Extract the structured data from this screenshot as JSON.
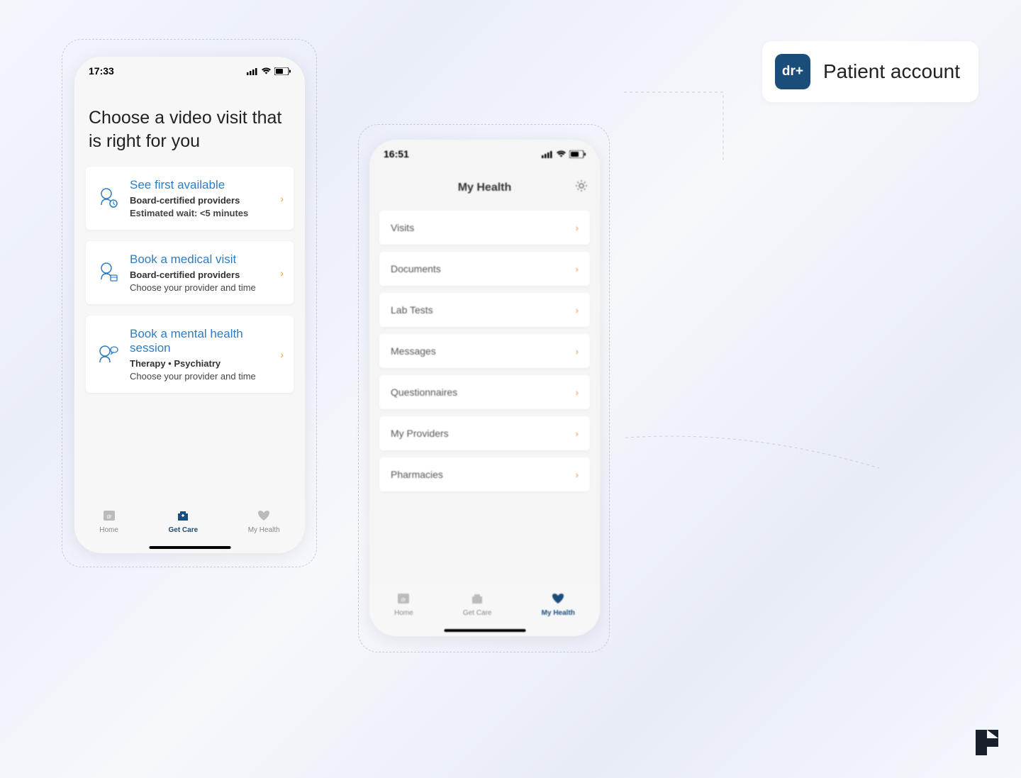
{
  "badge": {
    "logo_text": "dr+",
    "label": "Patient account"
  },
  "phone1": {
    "status_time": "17:33",
    "title": "Choose a video visit that is right for you",
    "cards": [
      {
        "title": "See first available",
        "line1": "Board-certified providers",
        "line2": "Estimated wait: <5 minutes",
        "icon": "doctor-clock-icon",
        "line2_bold": true
      },
      {
        "title": "Book a medical visit",
        "line1": "Board-certified providers",
        "line2": "Choose your provider and time",
        "icon": "doctor-calendar-icon",
        "line2_bold": false
      },
      {
        "title": "Book a mental health session",
        "line1": "Therapy • Psychiatry",
        "line2": "Choose your provider and time",
        "icon": "therapy-icon",
        "line2_bold": false
      }
    ],
    "tabs": [
      {
        "label": "Home",
        "icon": "home-icon",
        "active": false
      },
      {
        "label": "Get Care",
        "icon": "care-icon",
        "active": true
      },
      {
        "label": "My Health",
        "icon": "heart-icon",
        "active": false
      }
    ]
  },
  "phone2": {
    "status_time": "16:51",
    "header": "My Health",
    "rows": [
      {
        "label": "Visits"
      },
      {
        "label": "Documents"
      },
      {
        "label": "Lab Tests"
      },
      {
        "label": "Messages"
      },
      {
        "label": "Questionnaires"
      },
      {
        "label": "My Providers"
      },
      {
        "label": "Pharmacies"
      }
    ],
    "tabs": [
      {
        "label": "Home",
        "icon": "home-icon",
        "active": false
      },
      {
        "label": "Get Care",
        "icon": "care-icon",
        "active": false
      },
      {
        "label": "My Health",
        "icon": "heart-icon",
        "active": true
      }
    ]
  }
}
